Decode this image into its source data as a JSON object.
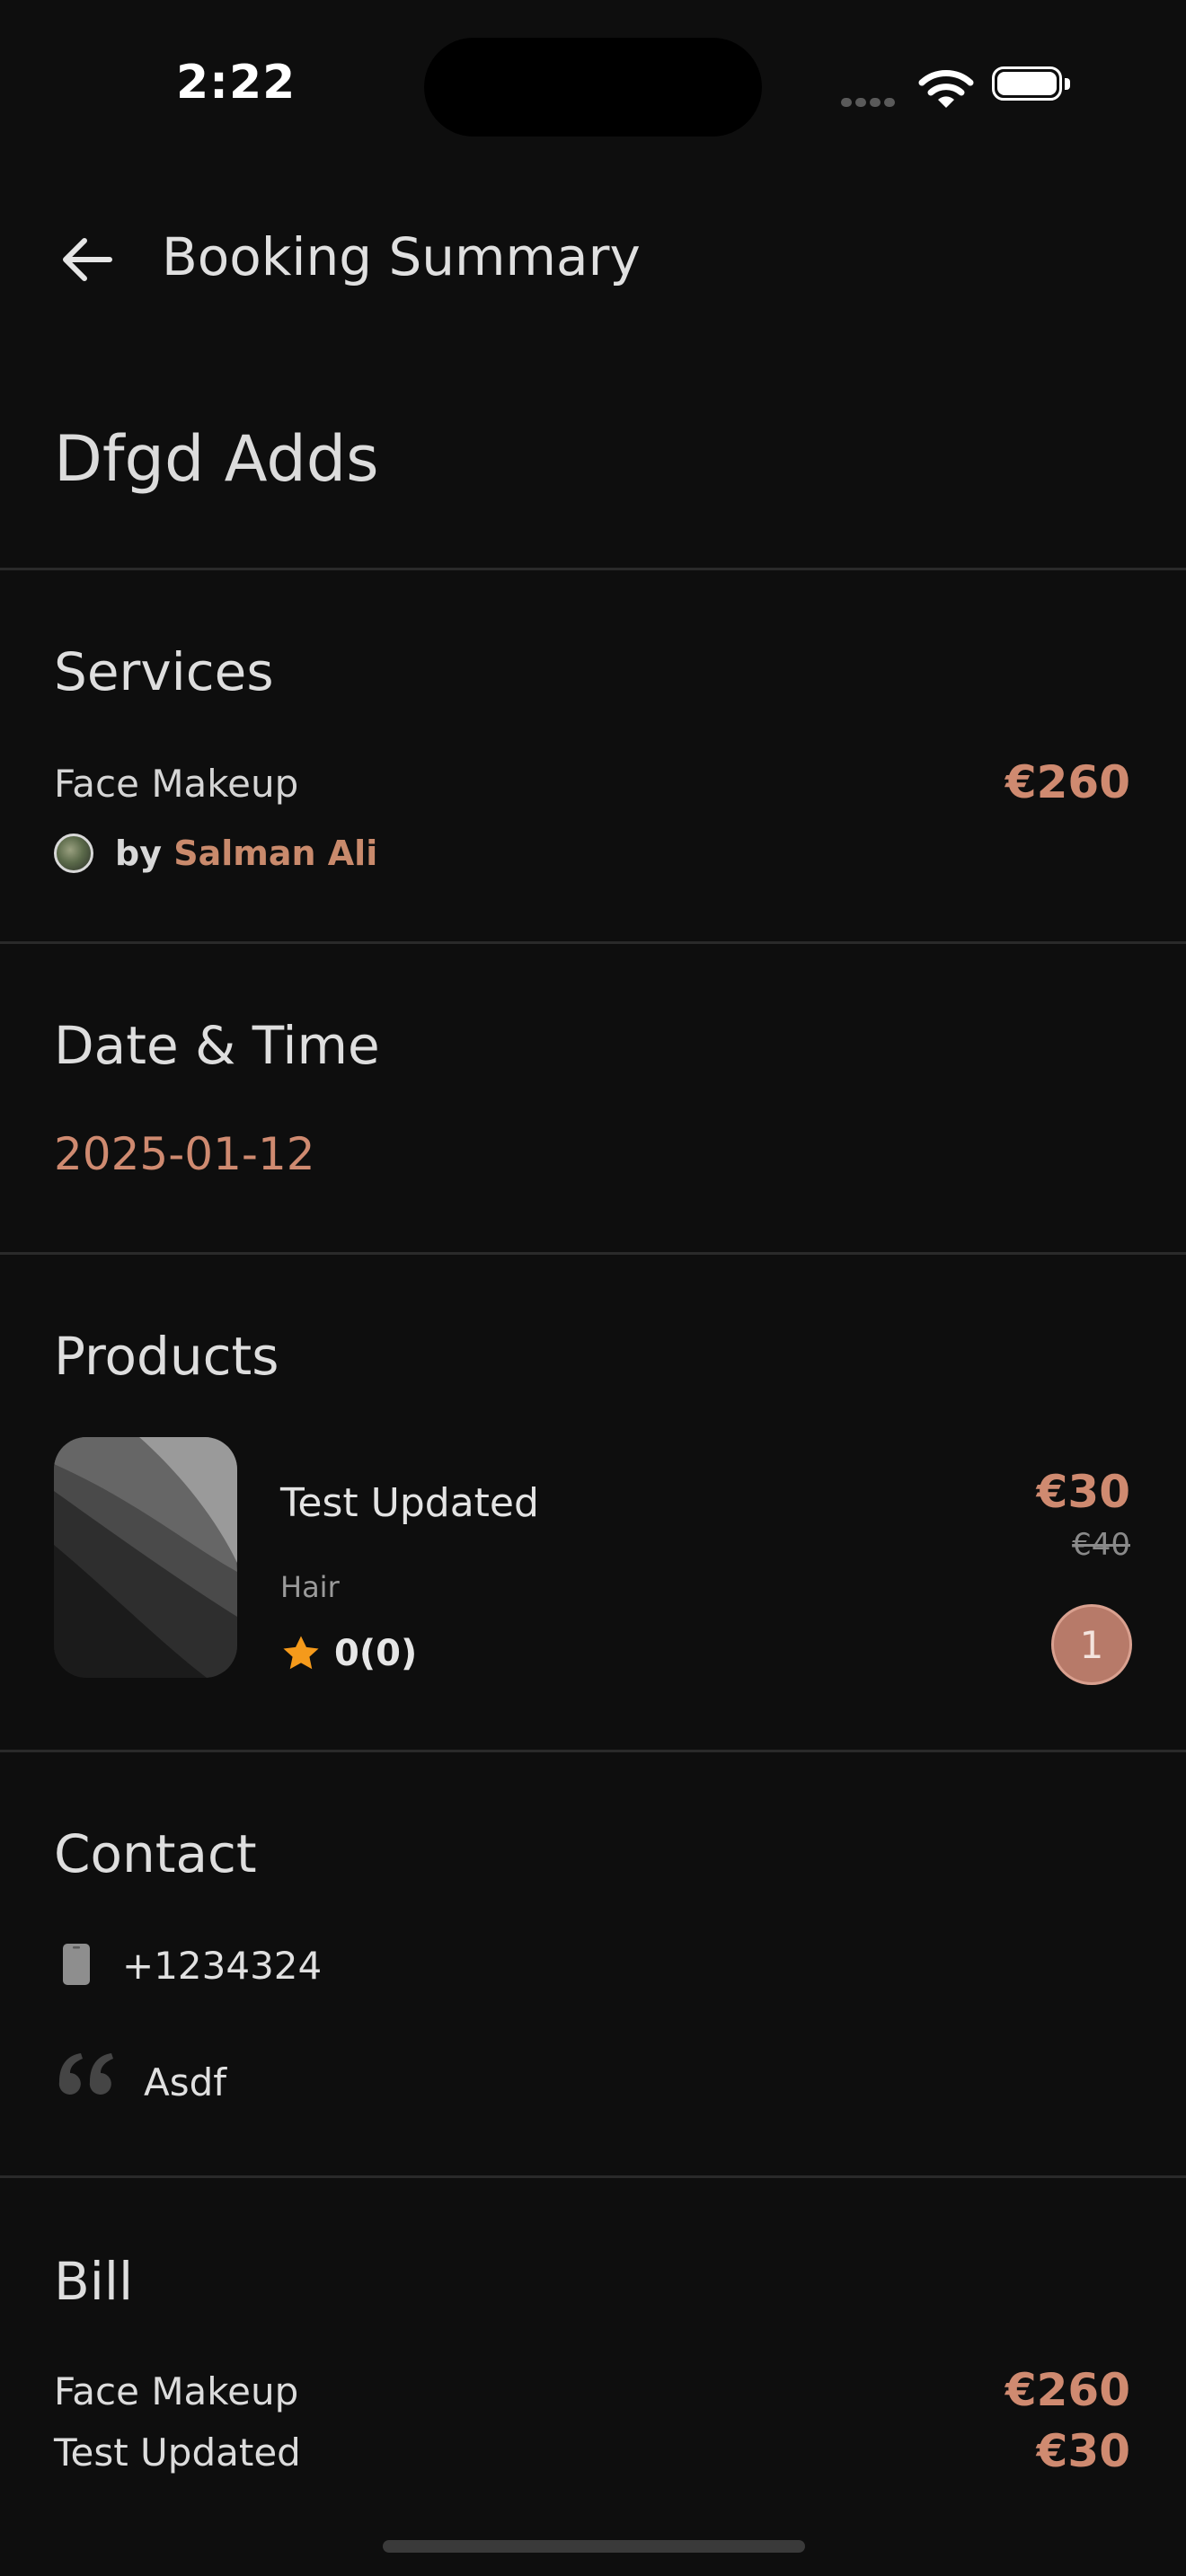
{
  "status_bar": {
    "time": "2:22"
  },
  "header": {
    "title": "Booking Summary"
  },
  "provider": {
    "name": "Dfgd Adds"
  },
  "services": {
    "title": "Services",
    "item": {
      "name": "Face Makeup",
      "price": "€260",
      "by_label": "by",
      "staff": "Salman Ali"
    }
  },
  "date_time": {
    "title": "Date & Time",
    "date": "2025-01-12"
  },
  "products": {
    "title": "Products",
    "item": {
      "name": "Test Updated",
      "category": "Hair",
      "rating": "0(0)",
      "price": "€30",
      "old_price": "€40",
      "quantity": "1"
    }
  },
  "contact": {
    "title": "Contact",
    "phone": "+1234324",
    "note": "Asdf"
  },
  "bill": {
    "title": "Bill",
    "rows": [
      {
        "label": "Face Makeup",
        "value": "€260"
      },
      {
        "label": "Test Updated",
        "value": "€30"
      }
    ]
  },
  "colors": {
    "accent": "#cf8a70",
    "background": "#0e0e0e",
    "star": "#f59a1b",
    "quantity_badge": "#b77a69"
  },
  "icons": [
    "back-arrow-icon",
    "wifi-icon",
    "battery-icon",
    "star-icon",
    "phone-icon",
    "quote-icon"
  ]
}
